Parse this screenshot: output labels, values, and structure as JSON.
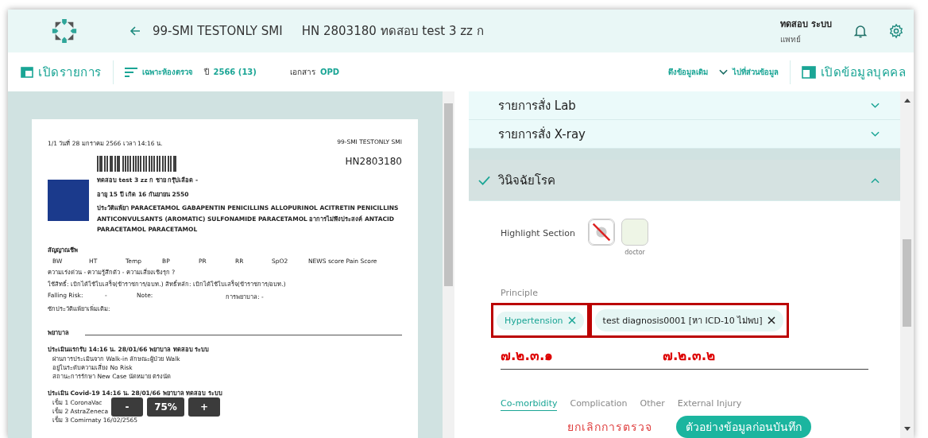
{
  "header": {
    "title": "99-SMI TESTONLY SMI",
    "patient": "HN 2803180 ทดสอบ test 3 zz ก",
    "user_name": "ทดสอบ ระบบ",
    "user_role": "แพทย์"
  },
  "toolbar": {
    "open_list": "เปิดรายการ",
    "filter": "เฉพาะห้องตรวจ",
    "year_label": "ปี",
    "year_value": "2566 (13)",
    "doc_label": "เอกสาร",
    "doc_value": "OPD",
    "pull_data": "ดึงข้อมูลเดิม",
    "goto_section": "ไปที่ส่วนข้อมูล",
    "open_person": "เปิดข้อมูลบุคคล"
  },
  "document": {
    "header_left": "1/1   วันที่ 28 มกราคม 2566   เวลา 14:16 น.",
    "header_right": "99-SMI TESTONLY SMI",
    "hn": "HN2803180",
    "patient_lines": [
      "ทดสอบ test 3 zz ก   ชาย   กรุ๊ปเลือด -",
      "อายุ 15 ปี   เกิด 16 กันยายน 2550",
      "ประวัติแพ้ยา PARACETAMOL GABAPENTIN PENICILLINS ALLOPURINOL ACITRETIN PENICILLINS ANTICONVULSANTS (AROMATIC) SULFONAMIDE PARACETAMOL    อาการไม่พึงประสงค์ ANTACID PARACETAMOL PARACETAMOL"
    ],
    "vitals_title": "สัญญาณชีพ",
    "vitals_columns": [
      "BW",
      "HT",
      "Temp",
      "BP",
      "PR",
      "RR",
      "SpO2",
      "NEWS score Pain Score"
    ],
    "lines": [
      "ความเร่งด่วน -   ความรู้สึกตัว -   ความเสี่ยงเชิงรุก ?",
      "ใช้สิทธิ์: เบิกได้ใช้ใบเสร็จ(ข้าราชการ/อบท.)   สิทธิ์หลัก: เบิกได้ใช้ใบเสร็จ(ข้าราชการ/อบท.)"
    ],
    "falling_risk": [
      "Falling Risk:",
      "-",
      "Note:",
      "การพยาบาล: -"
    ],
    "extra_history": "ซักประวัติแพ้ยาเพิ่มเติม:",
    "nursing_title": "พยาบาล",
    "blocks": [
      {
        "title": "ประเมินแรกรับ  14:16 น. 28/01/66 พยาบาล ทดสอบ ระบบ",
        "lines": [
          "ผ่านการประเมินจาก Walk-in  ลักษณะผู้ป่วย Walk",
          "อยู่ในระดับความเสี่ยง No Risk",
          "สถานะการรักษา New Case  นัดหมาย ตรงนัด"
        ]
      },
      {
        "title": "ประเมิน Covid-19  14:16 น. 28/01/66 พยาบาล ทดสอบ ระบบ",
        "lines": [
          "เข็ม 1  CoronaVac",
          "เข็ม 2  AstraZeneca",
          "เข็ม 3  Comirnaty  16/02/2565"
        ]
      }
    ]
  },
  "zoom": {
    "minus": "-",
    "level": "75%",
    "plus": "+"
  },
  "sections": [
    {
      "title": "รายการสั่ง Lab",
      "expanded": false,
      "done": false
    },
    {
      "title": "รายการสั่ง X-ray",
      "expanded": false,
      "done": false
    },
    {
      "title": "วินิจฉัยโรค",
      "expanded": true,
      "done": true
    }
  ],
  "highlight": {
    "label": "Highlight Section",
    "options": [
      {
        "kind": "none"
      },
      {
        "kind": "color",
        "color": "#eef5e6",
        "label": "doctor"
      }
    ]
  },
  "principle": {
    "label": "Principle",
    "chips": [
      {
        "label": "Hypertension",
        "kind": "coded",
        "annotation": "๗.๒.๓.๑"
      },
      {
        "label": "test diagnosis0001 [หา ICD-10 ไม่พบ]",
        "kind": "uncoded",
        "annotation": "๗.๒.๓.๒"
      }
    ]
  },
  "tabs": [
    {
      "label": "Co-morbidity",
      "selected": true
    },
    {
      "label": "Complication",
      "selected": false
    },
    {
      "label": "Other",
      "selected": false
    },
    {
      "label": "External Injury",
      "selected": false
    }
  ],
  "buttons": [
    {
      "label": "ยกเลิกการตรวจ",
      "kind": "text"
    },
    {
      "label": "ตัวอย่างข้อมูลก่อนบันทึก",
      "kind": "primary"
    }
  ]
}
